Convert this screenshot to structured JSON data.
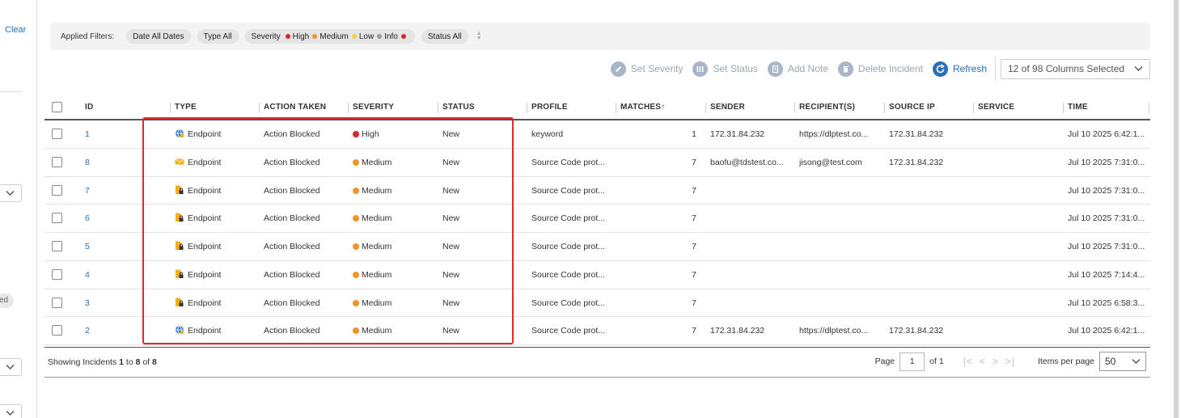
{
  "sidebar": {
    "clear_label": "Clear",
    "pill_label": "ed"
  },
  "filters": {
    "label": "Applied Filters:",
    "date_chip": "Date All Dates",
    "type_chip": "Type All",
    "severity_chip_title": "Severity",
    "severity_items": [
      {
        "label": "High",
        "color": "#d9262b"
      },
      {
        "label": "Medium",
        "color": "#f0932b"
      },
      {
        "label": "Low",
        "color": "#f5cf38"
      },
      {
        "label": "Info",
        "color": "#999999"
      }
    ],
    "severity_trailing_color": "#d9262b",
    "status_chip": "Status All"
  },
  "toolbar": {
    "set_severity": "Set Severity",
    "set_status": "Set Status",
    "add_note": "Add Note",
    "delete_incident": "Delete Incident",
    "refresh": "Refresh",
    "columns_selected": "12 of 98 Columns Selected"
  },
  "table": {
    "columns": [
      "ID",
      "TYPE",
      "ACTION TAKEN",
      "SEVERITY",
      "STATUS",
      "PROFILE",
      "MATCHES↑",
      "SENDER",
      "RECIPIENT(S)",
      "SOURCE IP",
      "SERVICE",
      "TIME"
    ],
    "rows": [
      {
        "id": "1",
        "type_icon": "globe",
        "type": "Endpoint",
        "action": "Action Blocked",
        "severity": "High",
        "sev_color": "#d9262b",
        "status": "New",
        "profile": "keyword",
        "matches": "1",
        "sender": "172.31.84.232",
        "recipients": "https://dlptest.co...",
        "source_ip": "172.31.84.232",
        "service": "",
        "time": "Jul 10 2025 6:42:1..."
      },
      {
        "id": "8",
        "type_icon": "mail",
        "type": "Endpoint",
        "action": "Action Blocked",
        "severity": "Medium",
        "sev_color": "#f0932b",
        "status": "New",
        "profile": "Source Code prot...",
        "matches": "7",
        "sender": "baofu@tdstest.co...",
        "recipients": "jisong@test.com",
        "source_ip": "172.31.84.232",
        "service": "",
        "time": "Jul 10 2025 7:31:0..."
      },
      {
        "id": "7",
        "type_icon": "file-lock",
        "type": "Endpoint",
        "action": "Action Blocked",
        "severity": "Medium",
        "sev_color": "#f0932b",
        "status": "New",
        "profile": "Source Code prot...",
        "matches": "7",
        "sender": "",
        "recipients": "",
        "source_ip": "",
        "service": "",
        "time": "Jul 10 2025 7:31:0..."
      },
      {
        "id": "6",
        "type_icon": "file-lock",
        "type": "Endpoint",
        "action": "Action Blocked",
        "severity": "Medium",
        "sev_color": "#f0932b",
        "status": "New",
        "profile": "Source Code prot...",
        "matches": "7",
        "sender": "",
        "recipients": "",
        "source_ip": "",
        "service": "",
        "time": "Jul 10 2025 7:31:0..."
      },
      {
        "id": "5",
        "type_icon": "file-lock",
        "type": "Endpoint",
        "action": "Action Blocked",
        "severity": "Medium",
        "sev_color": "#f0932b",
        "status": "New",
        "profile": "Source Code prot...",
        "matches": "7",
        "sender": "",
        "recipients": "",
        "source_ip": "",
        "service": "",
        "time": "Jul 10 2025 7:31:0..."
      },
      {
        "id": "4",
        "type_icon": "file-lock",
        "type": "Endpoint",
        "action": "Action Blocked",
        "severity": "Medium",
        "sev_color": "#f0932b",
        "status": "New",
        "profile": "Source Code prot...",
        "matches": "7",
        "sender": "",
        "recipients": "",
        "source_ip": "",
        "service": "",
        "time": "Jul 10 2025 7:14:4..."
      },
      {
        "id": "3",
        "type_icon": "file-lock",
        "type": "Endpoint",
        "action": "Action Blocked",
        "severity": "Medium",
        "sev_color": "#f0932b",
        "status": "New",
        "profile": "Source Code prot...",
        "matches": "7",
        "sender": "",
        "recipients": "",
        "source_ip": "",
        "service": "",
        "time": "Jul 10 2025 6:58:3..."
      },
      {
        "id": "2",
        "type_icon": "globe",
        "type": "Endpoint",
        "action": "Action Blocked",
        "severity": "Medium",
        "sev_color": "#f0932b",
        "status": "New",
        "profile": "Source Code prot...",
        "matches": "7",
        "sender": "172.31.84.232",
        "recipients": "https://dlptest.co...",
        "source_ip": "172.31.84.232",
        "service": "",
        "time": "Jul 10 2025 6:42:1..."
      }
    ]
  },
  "footer": {
    "showing_prefix": "Showing Incidents ",
    "showing_from": "1",
    "showing_to_word": " to ",
    "showing_to": "8",
    "showing_of_word": " of ",
    "showing_total": "8",
    "page_label": "Page",
    "page_value": "1",
    "page_of": "of 1",
    "items_per_page_label": "Items per page",
    "items_per_page_value": "50"
  }
}
